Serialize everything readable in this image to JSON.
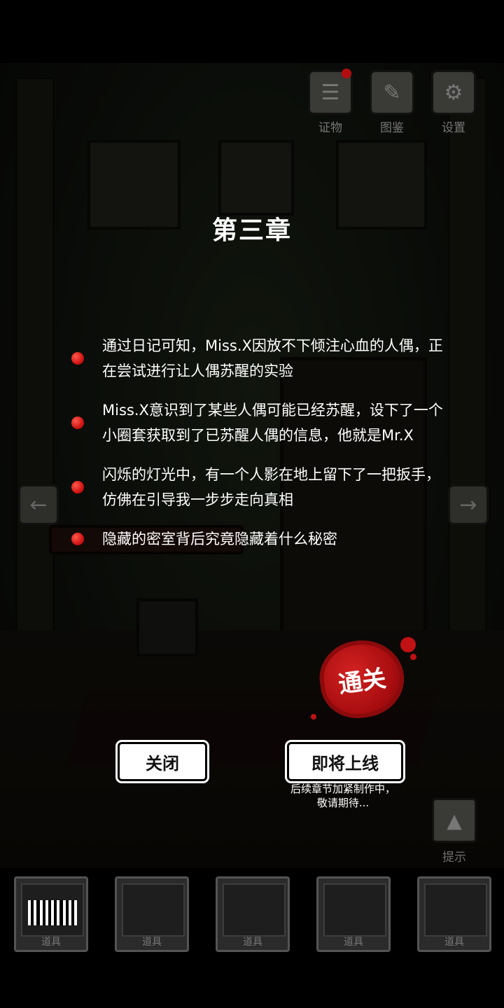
{
  "toolbar": {
    "evidence_label": "证物",
    "gallery_label": "图鉴",
    "settings_label": "设置"
  },
  "chapter": {
    "title": "第三章",
    "items": [
      "通过日记可知，Miss.X因放不下倾注心血的人偶，正在尝试进行让人偶苏醒的实验",
      "Miss.X意识到了某些人偶可能已经苏醒，设下了一个小圈套获取到了已苏醒人偶的信息，他就是Mr.X",
      "闪烁的灯光中，有一个人影在地上留下了一把扳手，仿佛在引导我一步步走向真相",
      "隐藏的密室背后究竟隐藏着什么秘密"
    ]
  },
  "seal": {
    "text": "通关",
    "color": "#b0100f"
  },
  "buttons": {
    "close_label": "关闭",
    "coming_soon_label": "即将上线",
    "coming_soon_note_line1": "后续章节加紧制作中，",
    "coming_soon_note_line2": "敬请期待..."
  },
  "hint": {
    "label": "提示"
  },
  "inventory": {
    "slots": [
      {
        "label": "道具",
        "item": "barcode-card"
      },
      {
        "label": "道具",
        "item": ""
      },
      {
        "label": "道具",
        "item": ""
      },
      {
        "label": "道具",
        "item": ""
      },
      {
        "label": "道具",
        "item": ""
      }
    ]
  },
  "icons": {
    "evidence": "notepad-icon",
    "gallery": "book-pen-icon",
    "settings": "gear-icon",
    "nav_left": "arrow-left-icon",
    "nav_right": "arrow-right-icon",
    "hint": "eye-pyramid-icon",
    "bullet": "red-dot-icon"
  },
  "colors": {
    "bullet": "#d11414",
    "text": "#ffffff",
    "background": "#000000"
  }
}
